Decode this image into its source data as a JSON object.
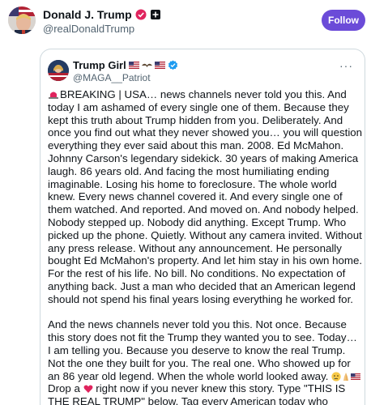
{
  "outer_post": {
    "author_name": "Donald J. Trump",
    "author_handle": "@realDonaldTrump",
    "follow_label": "Follow"
  },
  "quoted_post": {
    "author_name": "Trump Girl",
    "author_handle": "@MAGA__Patriot",
    "more_label": "···",
    "paragraph1": "BREAKING | USA… news channels never told you this. And today I am ashamed of every single one of them. Because they kept this truth about Trump hidden from you. Deliberately. And once you find out what they never showed you… you will question everything they ever said about this man. 2008. Ed McMahon. Johnny Carson's legendary sidekick. 30 years of making America laugh. 86 years old. And facing the most humiliating ending imaginable. Losing his home to foreclosure. The whole world knew. Every news channel covered it. And every single one of them watched. And reported. And moved on. And nobody helped. Nobody stepped up. Nobody did anything. Except Trump. Who picked up the phone. Quietly. Without any camera invited. Without any press release. Without any announcement. He personally bought Ed McMahon's property. And let him stay in his own home. For the rest of his life. No bill. No conditions. No expectation of anything back. Just a man who decided that an American legend should not spend his final years losing everything he worked for.",
    "paragraph2a": "And the news channels never told you this. Not once. Because this story does not fit the Trump they wanted you to see. Today… I am telling you. Because you deserve to know the real Trump. Not the one they built for you. The real one. Who showed up for an 86 year old legend. When the whole world looked away. ",
    "paragraph2b": " Drop a ",
    "paragraph2c": " right now if you never knew this story. Type \"THIS IS THE REAL TRUMP\" below. Tag every American today who deserves to know the truth that news channels never told them."
  },
  "icons": {
    "gov_badge": "government-affiliation-badge",
    "affil_badge": "square-affiliate-badge",
    "verified": "verified-badge-icon",
    "siren": "rotating-light-icon",
    "flags": [
      "us-flag-icon",
      "eagle-icon",
      "us-flag-icon"
    ],
    "emojis_inline": [
      "crying-face-icon",
      "folded-hands-icon",
      "us-flag-icon"
    ],
    "heart": "red-heart-icon"
  },
  "colors": {
    "follow_bg": "#6b4bd8",
    "verified_blue": "#1d9bf0",
    "text": "#0f1419",
    "secondary": "#536471"
  }
}
